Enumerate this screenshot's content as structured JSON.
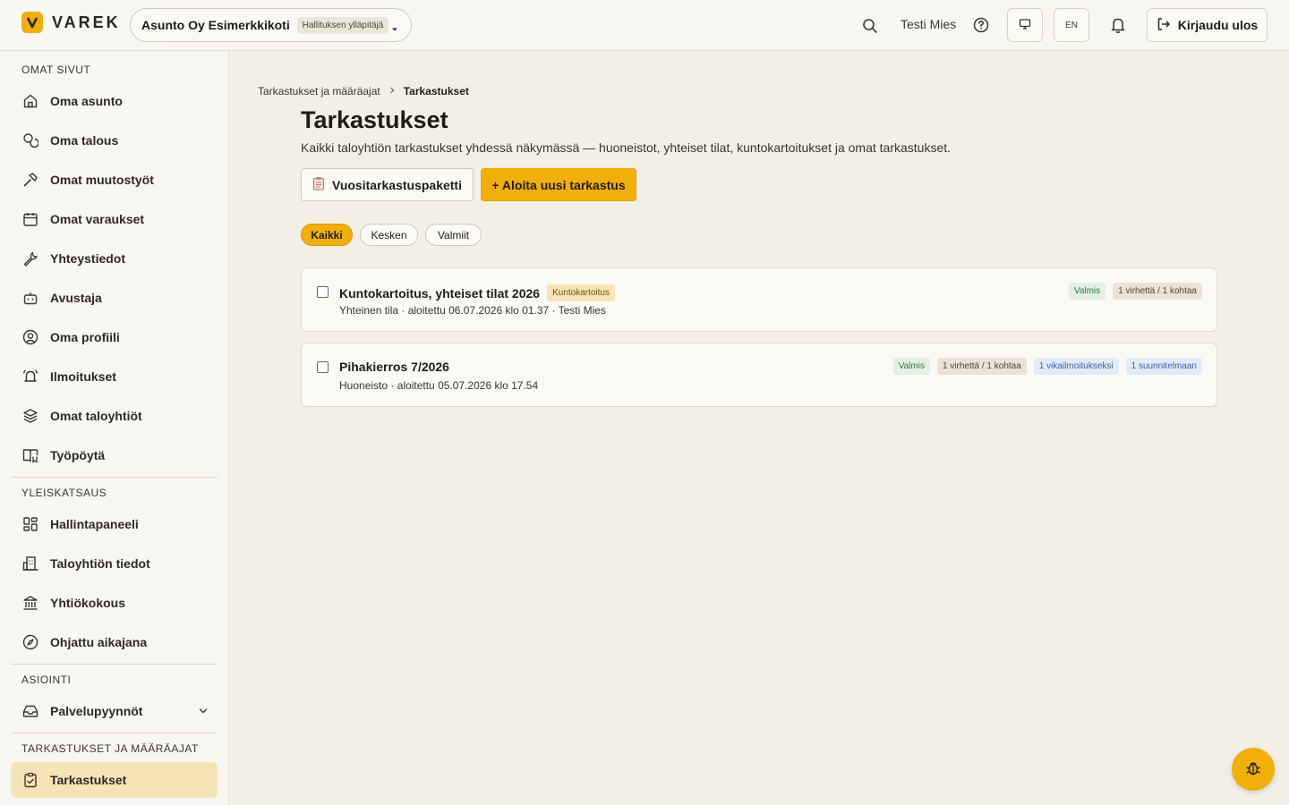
{
  "header": {
    "logo_text": "VAREK",
    "org_name": "Asunto Oy Esimerkkikoti",
    "org_role": "Hallituksen ylläpitäjä",
    "user_name": "Testi Mies",
    "lang": "EN",
    "logout_label": "Kirjaudu ulos",
    "accent_color": "#f0b008"
  },
  "sidebar": {
    "sections": [
      {
        "title": "OMAT SIVUT",
        "items": [
          {
            "label": "Oma asunto",
            "icon": "home-icon"
          },
          {
            "label": "Oma talous",
            "icon": "coins-icon"
          },
          {
            "label": "Omat muutostyöt",
            "icon": "hammer-icon"
          },
          {
            "label": "Omat varaukset",
            "icon": "calendar-icon"
          },
          {
            "label": "Yhteystiedot",
            "icon": "wrench-icon"
          },
          {
            "label": "Avustaja",
            "icon": "bot-icon"
          },
          {
            "label": "Oma profiili",
            "icon": "user-circle-icon"
          },
          {
            "label": "Ilmoitukset",
            "icon": "bell-ring-icon"
          },
          {
            "label": "Omat taloyhtiöt",
            "icon": "layers-icon"
          },
          {
            "label": "Työpöytä",
            "icon": "book-open-icon"
          }
        ]
      },
      {
        "title": "YLEISKATSAUS",
        "items": [
          {
            "label": "Hallintapaneeli",
            "icon": "dashboard-icon"
          },
          {
            "label": "Taloyhtiön tiedot",
            "icon": "building-icon"
          },
          {
            "label": "Yhtiökokous",
            "icon": "landmark-icon"
          },
          {
            "label": "Ohjattu aikajana",
            "icon": "compass-icon"
          }
        ]
      },
      {
        "title": "ASIOINTI",
        "items": [
          {
            "label": "Palvelupyynnöt",
            "icon": "inbox-icon"
          }
        ]
      },
      {
        "title": "TARKASTUKSET JA MÄÄRÄAJAT",
        "items": [
          {
            "label": "Tarkastukset",
            "icon": "clipboard-check-icon",
            "active": true
          }
        ]
      }
    ]
  },
  "breadcrumb": {
    "parent": "Tarkastukset ja määräajat",
    "current": "Tarkastukset"
  },
  "page": {
    "title": "Tarkastukset",
    "subtitle": "Kaikki taloyhtiön tarkastukset yhdessä näkymässä — huoneistot, yhteiset tilat, kuntokartoitukset ja omat tarkastukset.",
    "btn_package": "Vuositarkastuspaketti",
    "btn_new": "+ Aloita uusi tarkastus"
  },
  "filters": {
    "all": "Kaikki",
    "in_progress": "Kesken",
    "done": "Valmiit",
    "selected": "Kaikki"
  },
  "inspections": [
    {
      "title": "Kuntokartoitus, yhteiset tilat 2026",
      "type_tag": "Kuntokartoitus",
      "meta": "Yhteinen tila · aloitettu 06.07.2026 klo 01.37 · Testi Mies",
      "badges": [
        {
          "text": "Valmis",
          "kind": "green"
        },
        {
          "text": "1 virhettä / 1 kohtaa",
          "kind": "gray"
        }
      ]
    },
    {
      "title": "Pihakierros 7/2026",
      "type_tag": "",
      "meta": "Huoneisto · aloitettu 05.07.2026 klo 17.54",
      "badges": [
        {
          "text": "Valmis",
          "kind": "green"
        },
        {
          "text": "1 virhettä / 1 kohtaa",
          "kind": "gray"
        },
        {
          "text": "1 vikailmoitukseksi",
          "kind": "blue"
        },
        {
          "text": "1 suunnitelmaan",
          "kind": "blue"
        }
      ]
    }
  ]
}
